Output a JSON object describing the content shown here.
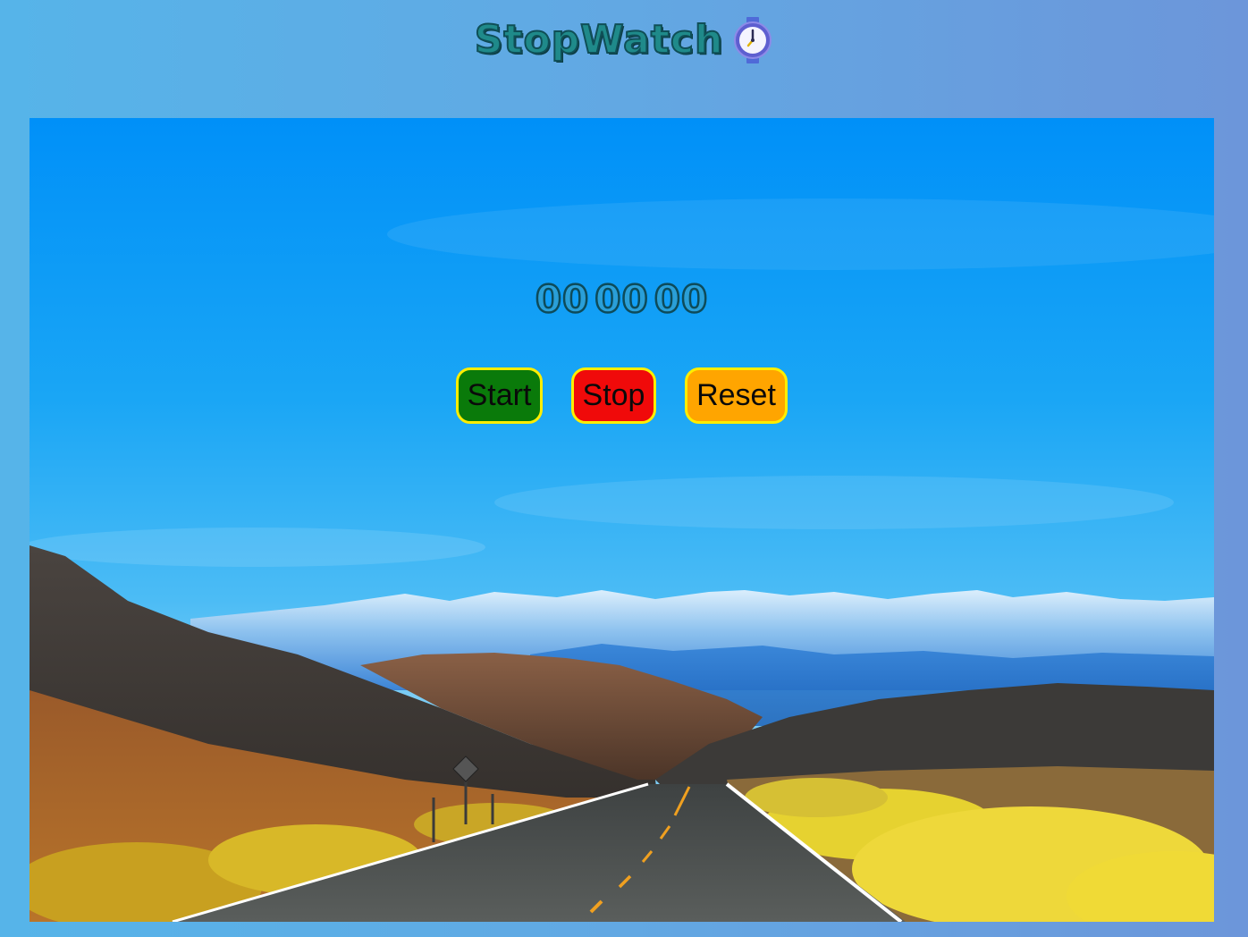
{
  "header": {
    "title": "StopWatch",
    "icon": "stopwatch-icon"
  },
  "timer": {
    "hours": "00",
    "minutes": "00",
    "seconds": "00"
  },
  "controls": {
    "start_label": "Start",
    "stop_label": "Stop",
    "reset_label": "Reset"
  },
  "colors": {
    "start": "#0a7a0a",
    "stop": "#f00a0a",
    "reset": "#ffa500",
    "button_border": "#ffee00",
    "title": "#1f8a8a"
  }
}
